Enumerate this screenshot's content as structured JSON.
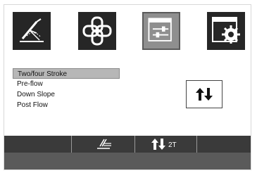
{
  "toolbar": {
    "tiles": [
      {
        "icon": "welding-torch-icon"
      },
      {
        "icon": "chain-link-icon"
      },
      {
        "icon": "sliders-icon",
        "selected": true
      },
      {
        "icon": "settings-gear-icon"
      }
    ]
  },
  "menu": {
    "items": [
      {
        "label": "Two/four Stroke",
        "selected": true
      },
      {
        "label": "Pre-flow"
      },
      {
        "label": "Down Slope"
      },
      {
        "label": "Post  Flow"
      }
    ]
  },
  "mode_indicator": {
    "icon": "up-down-arrows-icon"
  },
  "status_bar": {
    "mode_label": "2T",
    "icons": [
      "weld-pen-icon",
      "up-down-arrows-icon"
    ]
  },
  "colors": {
    "tile_bg": "#262626",
    "tile_selected_bg": "#8f8f8f",
    "bar_bg": "#3a3a3a",
    "highlight": "#b7b7b7"
  }
}
